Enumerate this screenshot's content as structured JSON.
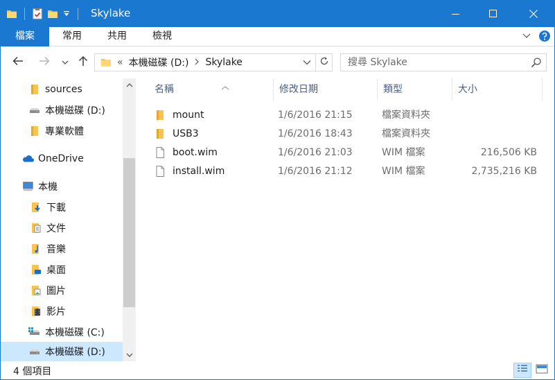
{
  "window": {
    "title": "Skylake"
  },
  "ribbon": {
    "tabs": [
      "檔案",
      "常用",
      "共用",
      "檢視"
    ]
  },
  "address_bar": {
    "overflow": "«",
    "crumbs": [
      "本機磁碟 (D:)",
      "Skylake"
    ]
  },
  "search": {
    "placeholder": "搜尋 Skylake"
  },
  "nav_pane": {
    "items": [
      {
        "label": "sources",
        "icon": "folder-icon"
      },
      {
        "label": "本機磁碟 (D:)",
        "icon": "drive-icon"
      },
      {
        "label": "專業軟體",
        "icon": "folder-icon"
      },
      {
        "label": "OneDrive",
        "icon": "onedrive-icon"
      },
      {
        "label": "本機",
        "icon": "computer-icon"
      },
      {
        "label": "下載",
        "icon": "downloads-icon"
      },
      {
        "label": "文件",
        "icon": "documents-icon"
      },
      {
        "label": "音樂",
        "icon": "music-icon"
      },
      {
        "label": "桌面",
        "icon": "desktop-icon"
      },
      {
        "label": "圖片",
        "icon": "pictures-icon"
      },
      {
        "label": "影片",
        "icon": "videos-icon"
      },
      {
        "label": "本機磁碟 (C:)",
        "icon": "windows-drive-icon"
      },
      {
        "label": "本機磁碟 (D:)",
        "icon": "drive-icon"
      }
    ],
    "selected_index": 12
  },
  "columns": [
    "名稱",
    "修改日期",
    "類型",
    "大小"
  ],
  "files": [
    {
      "name": "mount",
      "modified": "1/6/2016 21:15",
      "type": "檔案資料夾",
      "size": "",
      "icon": "folder-icon"
    },
    {
      "name": "USB3",
      "modified": "1/6/2016 18:43",
      "type": "檔案資料夾",
      "size": "",
      "icon": "folder-icon"
    },
    {
      "name": "boot.wim",
      "modified": "1/6/2016 21:03",
      "type": "WIM 檔案",
      "size": "216,506 KB",
      "icon": "file-icon"
    },
    {
      "name": "install.wim",
      "modified": "1/6/2016 21:12",
      "type": "WIM 檔案",
      "size": "2,735,216 KB",
      "icon": "file-icon"
    }
  ],
  "status": {
    "item_count": "4 個項目"
  },
  "colors": {
    "accent": "#1a78d1",
    "selection": "#cce8ff",
    "folder": "#f8c44f"
  }
}
